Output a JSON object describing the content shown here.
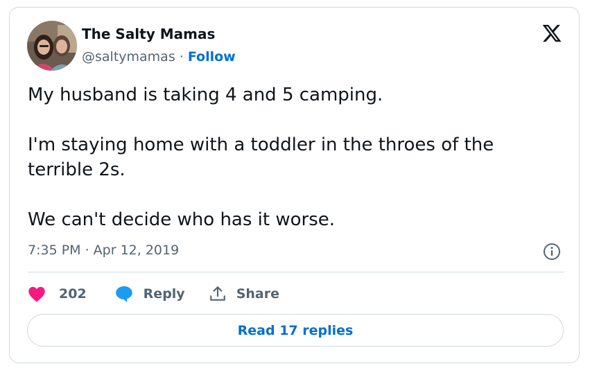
{
  "author": {
    "display_name": "The Salty Mamas",
    "handle": "@saltymamas",
    "separator": " · ",
    "follow_label": "Follow"
  },
  "tweet": {
    "paragraphs": [
      "My husband is taking 4 and 5 camping.",
      "I'm staying home with a toddler in the throes of the terrible 2s.",
      "We can't decide who has it worse."
    ],
    "timestamp": "7:35 PM · Apr 12, 2019"
  },
  "actions": {
    "like_count": "202",
    "reply_label": "Reply",
    "share_label": "Share"
  },
  "read_replies_label": "Read 17 replies",
  "icons": {
    "brand": "x-logo-icon",
    "info": "info-icon",
    "like": "heart-icon",
    "reply": "speech-bubble-icon",
    "share": "share-upload-icon"
  },
  "colors": {
    "text": "#0f1419",
    "secondary_text": "#536471",
    "link": "#006fd6",
    "heart": "#f91880",
    "reply_icon": "#1d9bf0",
    "border": "#cfd9de"
  }
}
